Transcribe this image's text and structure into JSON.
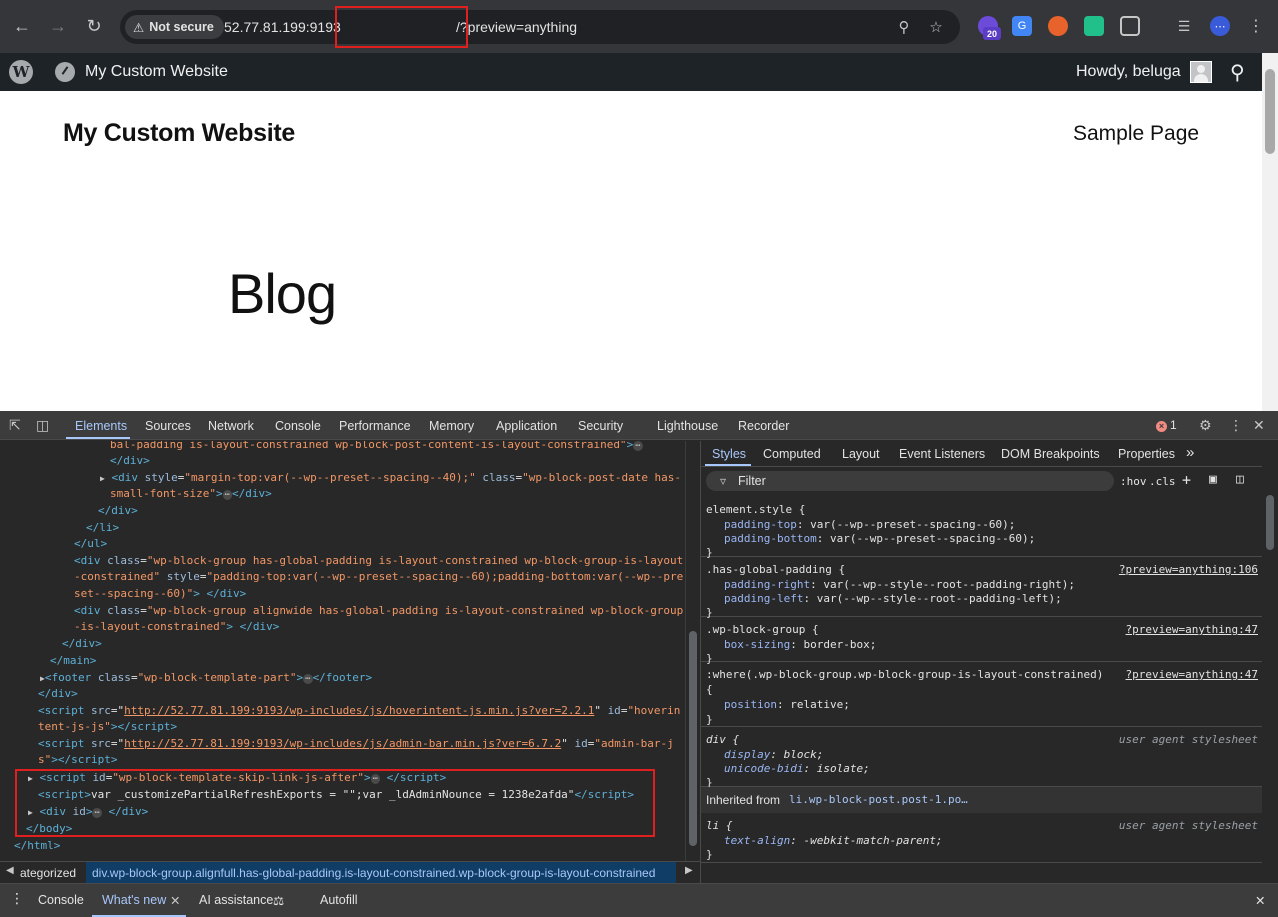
{
  "browser": {
    "security_label": "Not secure",
    "url_host": "52.77.81.199:9193",
    "url_path": "/?preview=anything",
    "ext_badge": "20"
  },
  "adminbar": {
    "site_title": "My Custom Website",
    "greeting": "Howdy, beluga"
  },
  "page": {
    "site_title": "My Custom Website",
    "nav_item": "Sample Page",
    "heading": "Blog"
  },
  "devtools": {
    "tabs": [
      "Elements",
      "Sources",
      "Network",
      "Console",
      "Performance",
      "Memory",
      "Application",
      "Security",
      "Lighthouse",
      "Recorder"
    ],
    "error_count": "1",
    "error_glyph": "×",
    "breadcrumb_left": "ategorized",
    "breadcrumb_main": "div.wp-block-group.alignfull.has-global-padding.is-layout-constrained.wp-block-group-is-layout-constrained",
    "styles_tabs": [
      "Styles",
      "Computed",
      "Layout",
      "Event Listeners",
      "DOM Breakpoints",
      "Properties"
    ],
    "filter_placeholder": "Filter",
    "hov": ":hov",
    "cls": ".cls",
    "drawer_tabs": [
      "Console",
      "What's new",
      "AI assistance",
      "Autofill"
    ],
    "inherited_label": "Inherited from",
    "inherited_link": "li.wp-block-post.post-1.po…",
    "user_agent": "user agent stylesheet",
    "src1": "?preview=anything:106",
    "src2": "?preview=anything:47"
  },
  "icons": [
    "back-icon",
    "forward-icon",
    "reload-icon",
    "info-icon",
    "zoom-icon",
    "star-icon",
    "extensions-icon",
    "media-icon",
    "profile-icon",
    "menu-icon",
    "wordpress-icon",
    "dashboard-icon",
    "search-icon",
    "inspect-icon",
    "device-icon",
    "gear-icon",
    "close-icon"
  ]
}
